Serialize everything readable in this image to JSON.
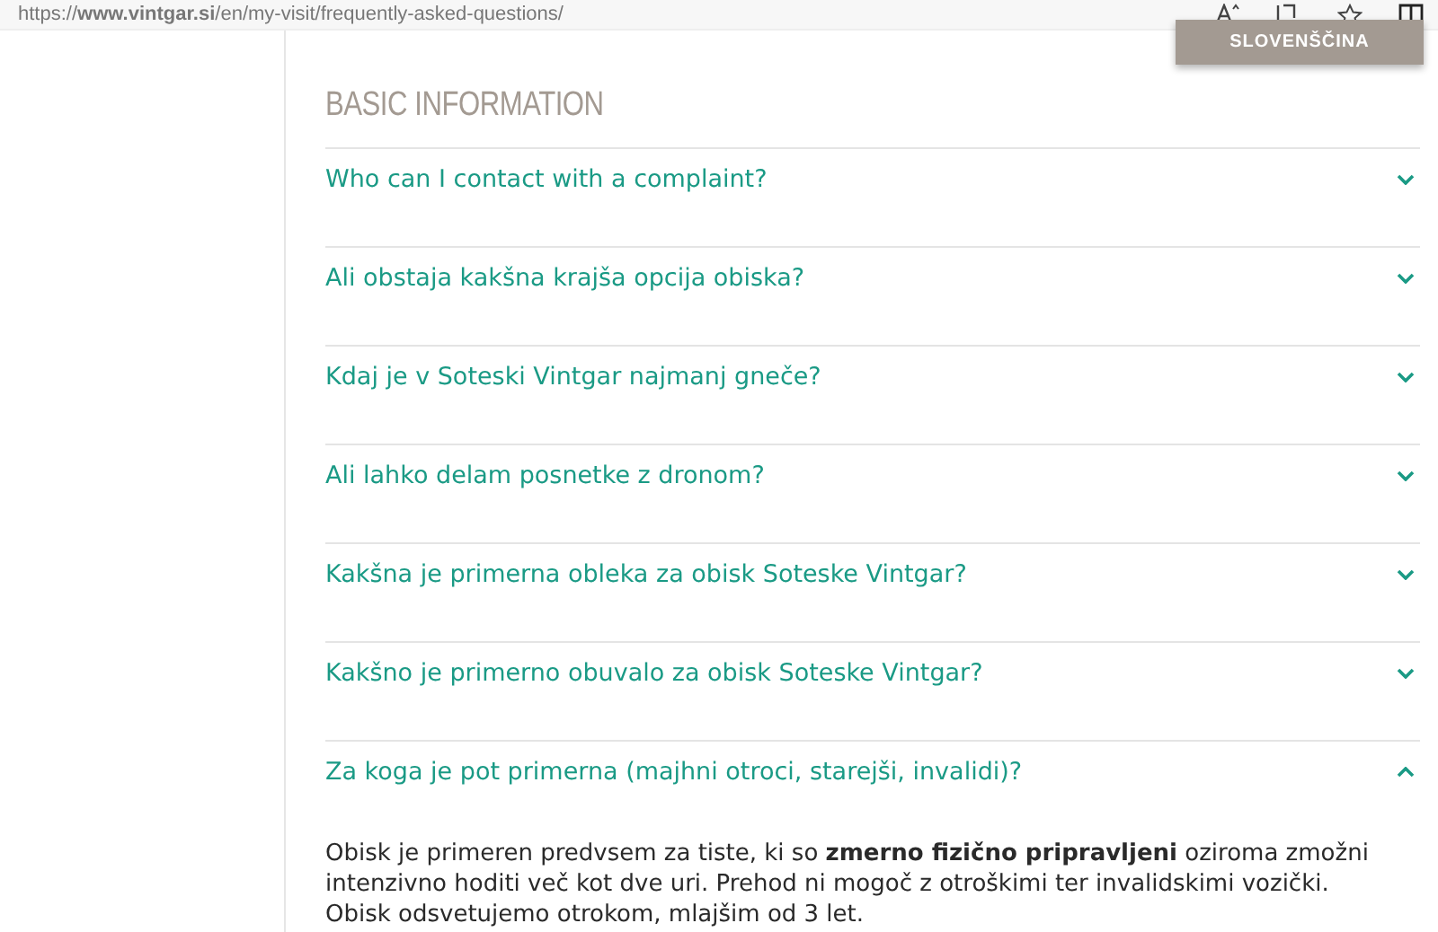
{
  "address_bar": {
    "url": "https://**www.vintgar.si**/en/my-visit/frequently-asked-questions/"
  },
  "language_button": {
    "label": "SLOVENŠČINA"
  },
  "section": {
    "title": "BASIC INFORMATION"
  },
  "faq": [
    {
      "question": "Who can I contact with a complaint?",
      "expanded": false
    },
    {
      "question": "Ali obstaja kakšna krajša opcija obiska?",
      "expanded": false
    },
    {
      "question": "Kdaj je v Soteski Vintgar najmanj gneče?",
      "expanded": false
    },
    {
      "question": "Ali lahko delam posnetke z dronom?",
      "expanded": false
    },
    {
      "question": "Kakšna je primerna obleka za obisk Soteske Vintgar?",
      "expanded": false
    },
    {
      "question": "Kakšno je primerno obuvalo za obisk Soteske Vintgar?",
      "expanded": false
    },
    {
      "question": "Za koga je pot primerna (majhni otroci, starejši, invalidi)?",
      "expanded": true,
      "answer": "Obisk je primeren predvsem za tiste, ki so **zmerno fizično pripravljeni** oziroma zmožni intenzivno hoditi več kot dve uri. Prehod ni mogoč z otroškimi ter invalidskimi vozički. Obisk odsvetujemo otrokom, mlajšim od 3 let."
    }
  ]
}
